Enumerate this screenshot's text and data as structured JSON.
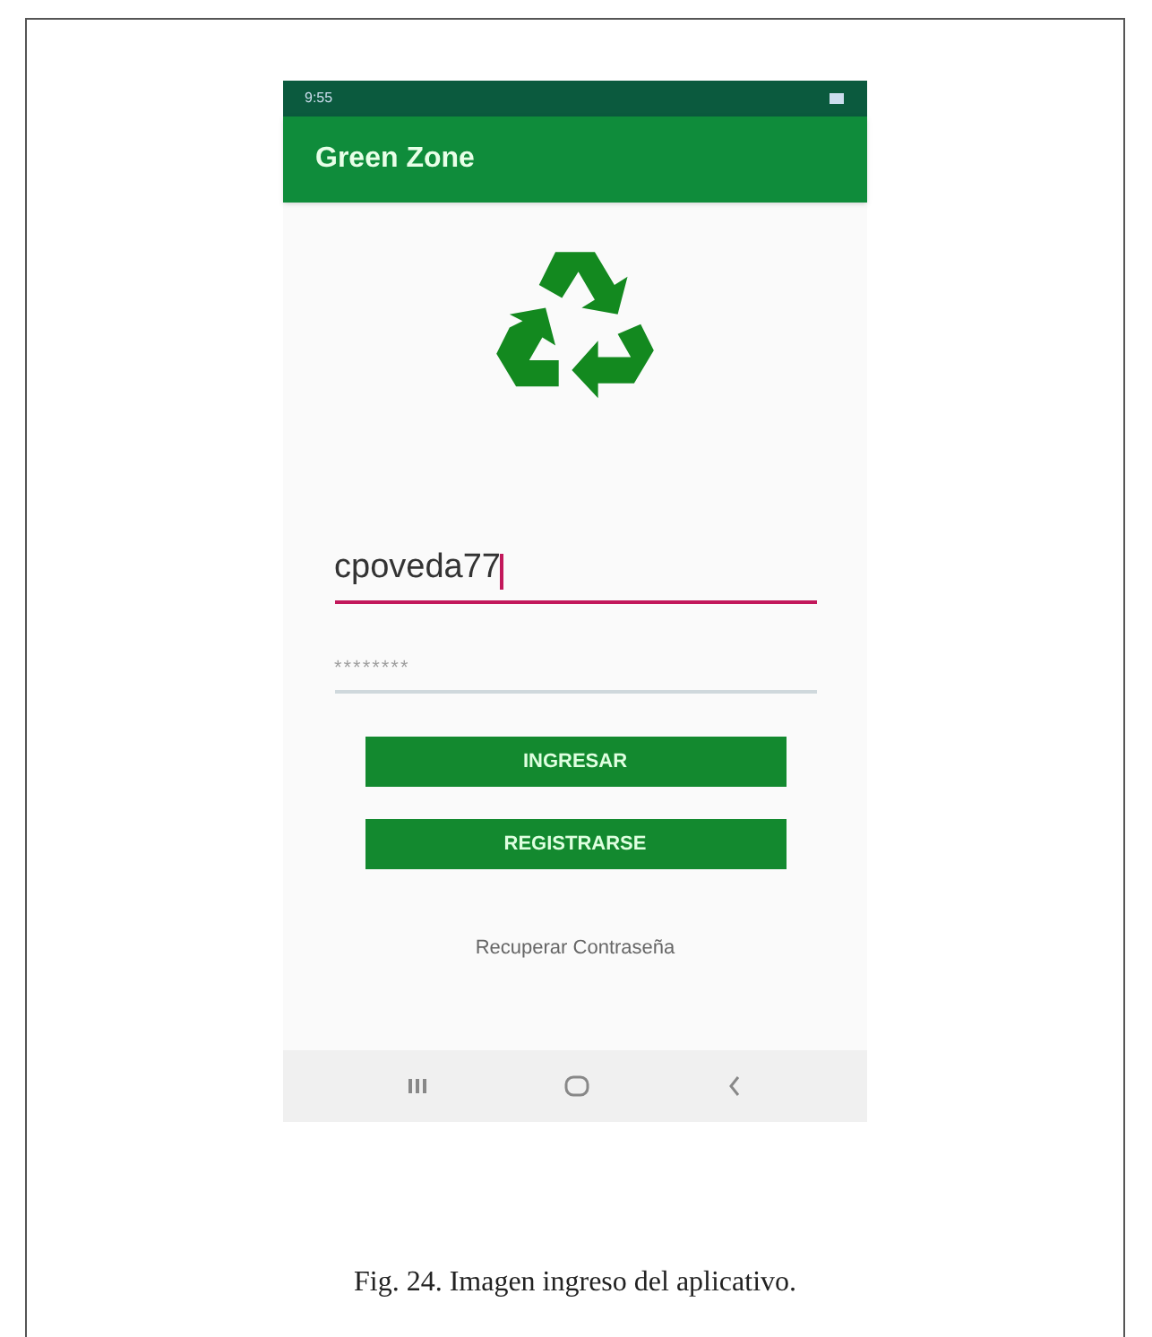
{
  "status_bar": {
    "time": "9:55"
  },
  "app_bar": {
    "title": "Green Zone"
  },
  "username": {
    "value": "cpoveda77",
    "focused": true
  },
  "password": {
    "value": "********",
    "focused": false
  },
  "buttons": [
    {
      "label": "INGRESAR"
    },
    {
      "label": "REGISTRARSE"
    }
  ],
  "link": "Recuperar Contraseña",
  "caption": "Fig. 24. Imagen ingreso del aplicativo."
}
